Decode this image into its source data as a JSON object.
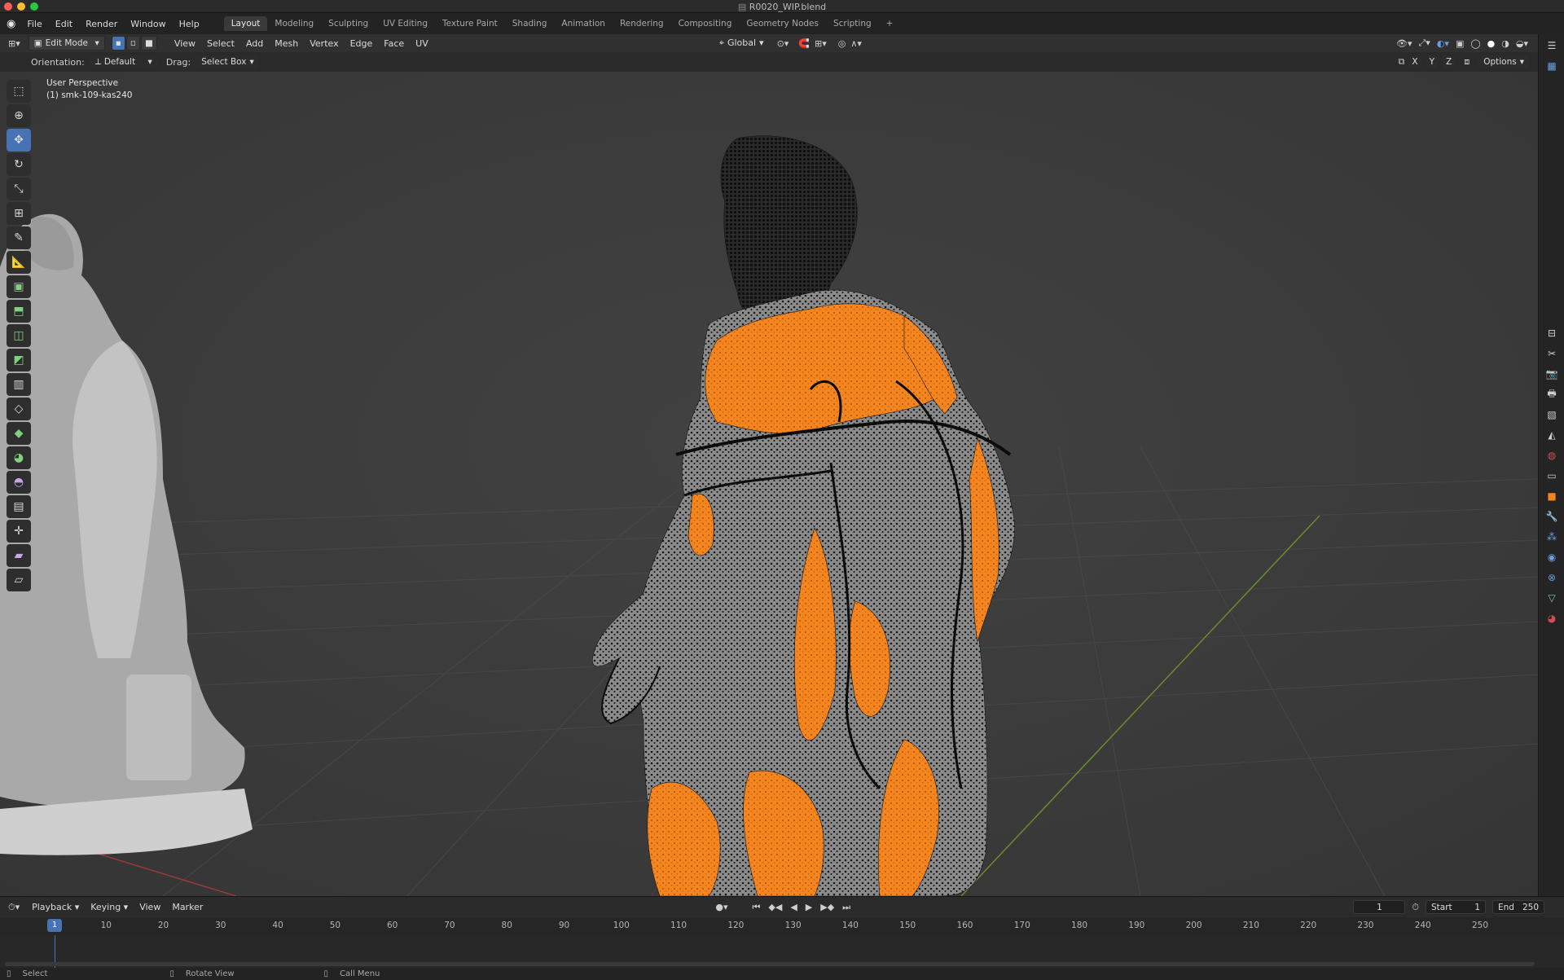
{
  "window": {
    "title": "R0020_WIP.blend"
  },
  "menu": [
    "File",
    "Edit",
    "Render",
    "Window",
    "Help"
  ],
  "workspaces": [
    "Layout",
    "Modeling",
    "Sculpting",
    "UV Editing",
    "Texture Paint",
    "Shading",
    "Animation",
    "Rendering",
    "Compositing",
    "Geometry Nodes",
    "Scripting"
  ],
  "active_workspace": "Layout",
  "add_workspace": "+",
  "header": {
    "mode": "Edit Mode",
    "view_menus": [
      "View",
      "Select",
      "Add",
      "Mesh",
      "Vertex",
      "Edge",
      "Face",
      "UV"
    ],
    "transform_orientation": "Global",
    "orientation_label": "Orientation:",
    "orientation_value": "Default",
    "drag_label": "Drag:",
    "drag_value": "Select Box",
    "options": "Options",
    "axes": [
      "X",
      "Y",
      "Z"
    ]
  },
  "viewport": {
    "view_name": "User Perspective",
    "object_name": "(1) smk-109-kas240",
    "selection_color": "#f5861f",
    "background": "#3d3d3d"
  },
  "tools": [
    "cursor-select-icon",
    "3d-cursor-icon",
    "move-icon",
    "rotate-icon",
    "scale-icon",
    "transform-icon",
    "annotate-icon",
    "measure-icon",
    "add-cube-icon",
    "extrude-icon",
    "inset-icon",
    "bevel-icon",
    "loop-cut-icon",
    "knife-icon",
    "poly-build-icon",
    "spin-icon",
    "smooth-icon",
    "edge-slide-icon",
    "shrink-fatten-icon",
    "shear-icon",
    "rip-icon"
  ],
  "timeline": {
    "menus": [
      "Playback",
      "Keying",
      "View",
      "Marker"
    ],
    "current_frame": "1",
    "start_label": "Start",
    "start": "1",
    "end_label": "End",
    "end": "250",
    "ticks": [
      "1",
      "10",
      "20",
      "30",
      "40",
      "50",
      "60",
      "70",
      "80",
      "90",
      "100",
      "110",
      "120",
      "130",
      "140",
      "150",
      "160",
      "170",
      "180",
      "190",
      "200",
      "210",
      "220",
      "230",
      "240",
      "250"
    ]
  },
  "status": {
    "select": "Select",
    "rotate_view": "Rotate View",
    "call_menu": "Call Menu"
  }
}
